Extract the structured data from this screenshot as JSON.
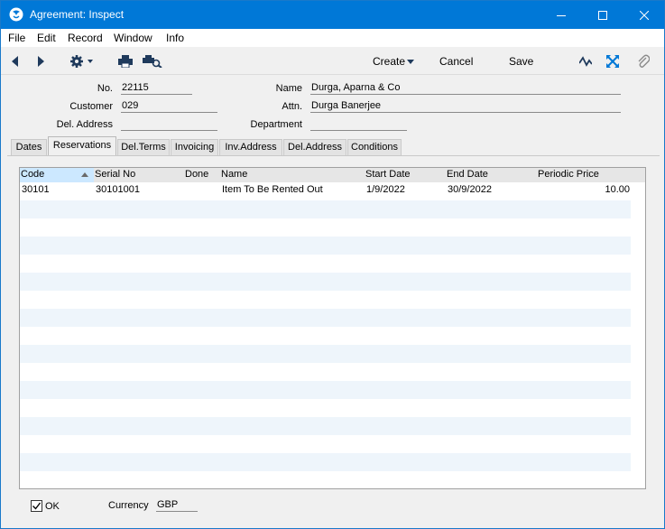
{
  "window": {
    "title": "Agreement: Inspect"
  },
  "menu": [
    "File",
    "Edit",
    "Record",
    "Window",
    "Info"
  ],
  "toolbar": {
    "create": "Create",
    "cancel": "Cancel",
    "save": "Save"
  },
  "header": {
    "no_label": "No.",
    "no_value": "22115",
    "customer_label": "Customer",
    "customer_value": "029",
    "deladdress_label": "Del. Address",
    "deladdress_value": "",
    "name_label": "Name",
    "name_value": "Durga, Aparna & Co",
    "attn_label": "Attn.",
    "attn_value": "Durga Banerjee",
    "department_label": "Department",
    "department_value": ""
  },
  "tabs": [
    "Dates",
    "Reservations",
    "Del.Terms",
    "Invoicing",
    "Inv.Address",
    "Del.Address",
    "Conditions"
  ],
  "active_tab": "Reservations",
  "grid": {
    "columns": [
      "Code",
      "Serial No",
      "Done",
      "Name",
      "Start Date",
      "End Date",
      "Periodic Price"
    ],
    "rows": [
      {
        "code": "30101",
        "serial": "30101001",
        "done": "",
        "name": "Item To Be Rented Out",
        "start": "1/9/2022",
        "end": "30/9/2022",
        "price": "10.00"
      }
    ]
  },
  "footer": {
    "ok_label": "OK",
    "ok_checked": true,
    "currency_label": "Currency",
    "currency_value": "GBP"
  }
}
